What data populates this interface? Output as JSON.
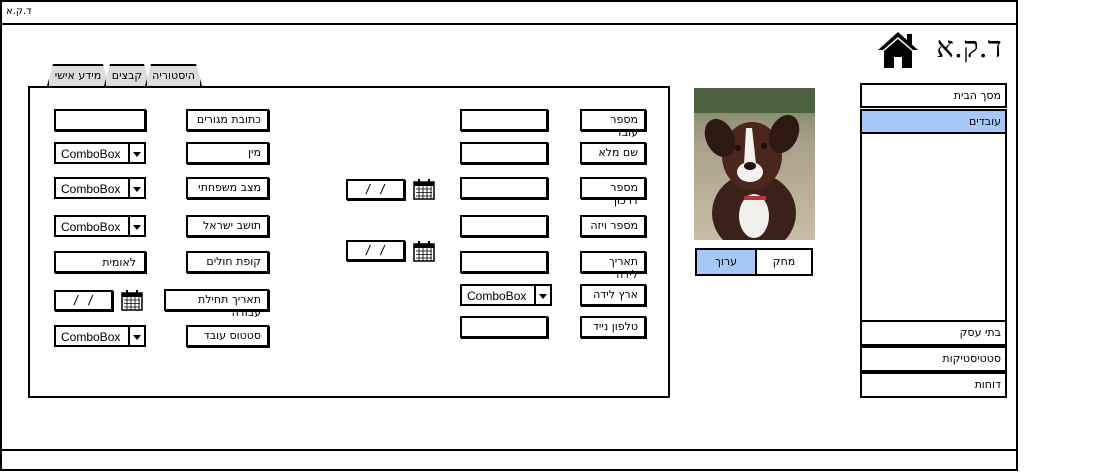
{
  "window": {
    "title": "ד.ק.א"
  },
  "app": {
    "logo_text": "ד.ק.א"
  },
  "sidebar": {
    "top_items": [
      {
        "label": "מסך הבית",
        "active": false
      },
      {
        "label": "עובדים",
        "active": true
      }
    ],
    "bottom_items": [
      {
        "label": "בתי עסק"
      },
      {
        "label": "סטטיסטיקות"
      },
      {
        "label": "דוחות"
      }
    ]
  },
  "actions": {
    "edit_label": "ערוך",
    "delete_label": "מחק"
  },
  "tabs": [
    {
      "label": "היסטוריה",
      "active": true
    },
    {
      "label": "קבצים",
      "active": false
    },
    {
      "label": "מידע אישי",
      "active": false
    }
  ],
  "form": {
    "right_labels": {
      "employee_number": "מספר  עובד",
      "full_name": "שם מלא",
      "passport_number": "מספר דרכון",
      "visa_number": "מספר ויזה",
      "birth_date": "תאריך לידה",
      "birth_country": "ארץ לידה",
      "mobile_phone": "טלפון נייד"
    },
    "left_labels": {
      "address": "כתובת מגורים",
      "gender": "מין",
      "marital_status": "מצב משפחתי",
      "israeli_resident": "תושב ישראל",
      "health_fund": "קופת חולים",
      "work_start_date": "תאריך תחילת עבודה",
      "employee_status": "סטטוס עובד"
    },
    "combo_placeholder": "ComboBox",
    "nationality_value": "לאומית",
    "date_placeholder": "/  /"
  },
  "colors": {
    "accent": "#a6c8f5",
    "border": "#000000",
    "tab_bg": "#dddddd"
  },
  "icons": {
    "home": "home-icon",
    "calendar": "calendar-icon",
    "dropdown": "chevron-down-icon"
  }
}
